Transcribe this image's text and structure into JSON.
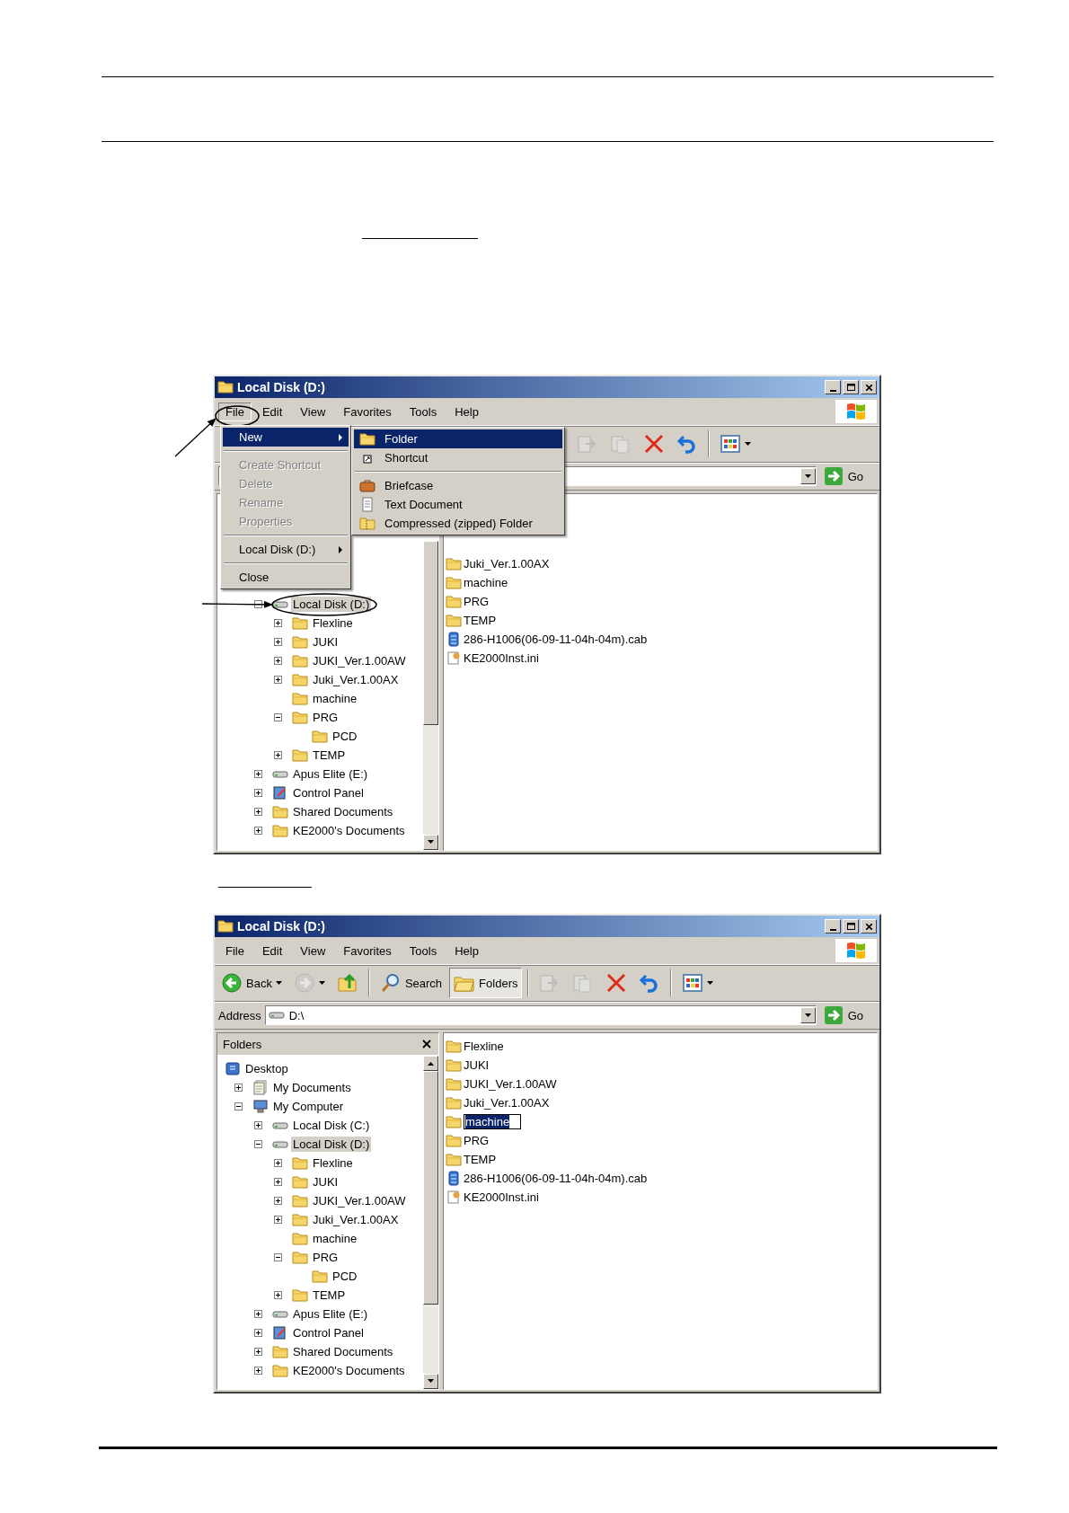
{
  "windows": [
    {
      "title": "Local Disk (D:)",
      "menubar": [
        {
          "label": "File",
          "selected": true
        },
        {
          "label": "Edit",
          "selected": false
        },
        {
          "label": "View",
          "selected": false
        },
        {
          "label": "Favorites",
          "selected": false
        },
        {
          "label": "Tools",
          "selected": false
        },
        {
          "label": "Help",
          "selected": false
        }
      ],
      "file_menu": {
        "items": [
          {
            "kind": "submenu",
            "label": "New",
            "selected": true,
            "disabled": false
          },
          {
            "kind": "separator"
          },
          {
            "kind": "item",
            "label": "Create Shortcut",
            "selected": false,
            "disabled": true
          },
          {
            "kind": "item",
            "label": "Delete",
            "selected": false,
            "disabled": true
          },
          {
            "kind": "item",
            "label": "Rename",
            "selected": false,
            "disabled": true
          },
          {
            "kind": "item",
            "label": "Properties",
            "selected": false,
            "disabled": true
          },
          {
            "kind": "separator"
          },
          {
            "kind": "submenu",
            "label": "Local Disk (D:)",
            "selected": false,
            "disabled": false
          },
          {
            "kind": "separator"
          },
          {
            "kind": "item",
            "label": "Close",
            "selected": false,
            "disabled": false
          }
        ],
        "submenu": [
          {
            "kind": "folder",
            "label": "Folder",
            "selected": true
          },
          {
            "kind": "shortcut",
            "label": "Shortcut",
            "selected": false
          },
          {
            "kind": "separator"
          },
          {
            "kind": "briefcase",
            "label": "Briefcase",
            "selected": false
          },
          {
            "kind": "text-document",
            "label": "Text Document",
            "selected": false
          },
          {
            "kind": "zip-folder",
            "label": "Compressed (zipped) Folder",
            "selected": false
          }
        ]
      },
      "toolbar": [
        {
          "kind": "move",
          "disabled": true,
          "pressed": false
        },
        {
          "kind": "copy",
          "disabled": true,
          "pressed": false
        },
        {
          "kind": "delete",
          "disabled": false,
          "pressed": false
        },
        {
          "kind": "undo",
          "disabled": false,
          "pressed": false
        },
        {
          "kind": "separator"
        },
        {
          "kind": "views",
          "disabled": false,
          "pressed": false
        }
      ],
      "address": {
        "go": "Go"
      },
      "tree": [
        {
          "label": "Local Disk (D:)",
          "kind": "drive",
          "selected": true,
          "expanded": true,
          "children": [
            {
              "label": "Flexline",
              "kind": "folder",
              "selected": false,
              "expanded": false
            },
            {
              "label": "JUKI",
              "kind": "folder",
              "selected": false,
              "expanded": false
            },
            {
              "label": "JUKI_Ver.1.00AW",
              "kind": "folder",
              "selected": false,
              "expanded": false
            },
            {
              "label": "Juki_Ver.1.00AX",
              "kind": "folder",
              "selected": false,
              "expanded": false
            },
            {
              "label": "machine",
              "kind": "folder",
              "selected": false
            },
            {
              "label": "PRG",
              "kind": "folder",
              "selected": false,
              "expanded": true,
              "children": [
                {
                  "label": "PCD",
                  "kind": "folder",
                  "selected": false
                }
              ]
            },
            {
              "label": "TEMP",
              "kind": "folder",
              "selected": false,
              "expanded": false
            }
          ]
        },
        {
          "label": "Apus Elite (E:)",
          "kind": "drive",
          "selected": false,
          "expanded": false
        },
        {
          "label": "Control Panel",
          "kind": "control-panel",
          "selected": false,
          "expanded": false
        },
        {
          "label": "Shared Documents",
          "kind": "folder",
          "selected": false,
          "expanded": false
        },
        {
          "label": "KE2000's Documents",
          "kind": "folder",
          "selected": false,
          "expanded": false
        }
      ],
      "files": [
        {
          "name": "Juki_Ver.1.00AX",
          "kind": "folder",
          "editing": false
        },
        {
          "name": "machine",
          "kind": "folder",
          "editing": false
        },
        {
          "name": "PRG",
          "kind": "folder",
          "editing": false
        },
        {
          "name": "TEMP",
          "kind": "folder",
          "editing": false
        },
        {
          "name": "286-H1006(06-09-11-04h-04m).cab",
          "kind": "cab",
          "editing": false
        },
        {
          "name": "KE2000Inst.ini",
          "kind": "ini",
          "editing": false
        }
      ]
    },
    {
      "title": "Local Disk (D:)",
      "menubar": [
        {
          "label": "File",
          "selected": false
        },
        {
          "label": "Edit",
          "selected": false
        },
        {
          "label": "View",
          "selected": false
        },
        {
          "label": "Favorites",
          "selected": false
        },
        {
          "label": "Tools",
          "selected": false
        },
        {
          "label": "Help",
          "selected": false
        }
      ],
      "toolbar": [
        {
          "kind": "back",
          "label": "Back",
          "disabled": false,
          "pressed": false
        },
        {
          "kind": "forward",
          "disabled": true,
          "pressed": false
        },
        {
          "kind": "up",
          "disabled": false,
          "pressed": false
        },
        {
          "kind": "separator"
        },
        {
          "kind": "search",
          "label": "Search",
          "disabled": false,
          "pressed": false
        },
        {
          "kind": "folders",
          "label": "Folders",
          "disabled": false,
          "pressed": true
        },
        {
          "kind": "separator"
        },
        {
          "kind": "move",
          "disabled": true,
          "pressed": false
        },
        {
          "kind": "copy",
          "disabled": true,
          "pressed": false
        },
        {
          "kind": "delete",
          "disabled": false,
          "pressed": false
        },
        {
          "kind": "undo",
          "disabled": false,
          "pressed": false
        },
        {
          "kind": "separator"
        },
        {
          "kind": "views",
          "disabled": false,
          "pressed": false
        }
      ],
      "address": {
        "label": "Address",
        "value": "D:\\",
        "go": "Go"
      },
      "folders_pane": {
        "title": "Folders"
      },
      "tree": [
        {
          "label": "Desktop",
          "kind": "desktop",
          "selected": false,
          "children": [
            {
              "label": "My Documents",
              "kind": "documents",
              "selected": false,
              "expanded": false
            },
            {
              "label": "My Computer",
              "kind": "computer",
              "selected": false,
              "expanded": true,
              "children": [
                {
                  "label": "Local Disk (C:)",
                  "kind": "drive",
                  "selected": false,
                  "expanded": false
                },
                {
                  "label": "Local Disk (D:)",
                  "kind": "drive",
                  "selected": true,
                  "expanded": true,
                  "children": [
                    {
                      "label": "Flexline",
                      "kind": "folder",
                      "selected": false,
                      "expanded": false
                    },
                    {
                      "label": "JUKI",
                      "kind": "folder",
                      "selected": false,
                      "expanded": false
                    },
                    {
                      "label": "JUKI_Ver.1.00AW",
                      "kind": "folder",
                      "selected": false,
                      "expanded": false
                    },
                    {
                      "label": "Juki_Ver.1.00AX",
                      "kind": "folder",
                      "selected": false,
                      "expanded": false
                    },
                    {
                      "label": "machine",
                      "kind": "folder",
                      "selected": false
                    },
                    {
                      "label": "PRG",
                      "kind": "folder",
                      "selected": false,
                      "expanded": true,
                      "children": [
                        {
                          "label": "PCD",
                          "kind": "folder",
                          "selected": false
                        }
                      ]
                    },
                    {
                      "label": "TEMP",
                      "kind": "folder",
                      "selected": false,
                      "expanded": false
                    }
                  ]
                },
                {
                  "label": "Apus Elite (E:)",
                  "kind": "drive",
                  "selected": false,
                  "expanded": false
                },
                {
                  "label": "Control Panel",
                  "kind": "control-panel",
                  "selected": false,
                  "expanded": false
                },
                {
                  "label": "Shared Documents",
                  "kind": "folder",
                  "selected": false,
                  "expanded": false
                },
                {
                  "label": "KE2000's Documents",
                  "kind": "folder",
                  "selected": false,
                  "expanded": false
                }
              ]
            }
          ]
        }
      ],
      "files": [
        {
          "name": "Flexline",
          "kind": "folder",
          "editing": false
        },
        {
          "name": "JUKI",
          "kind": "folder",
          "editing": false
        },
        {
          "name": "JUKI_Ver.1.00AW",
          "kind": "folder",
          "editing": false
        },
        {
          "name": "Juki_Ver.1.00AX",
          "kind": "folder",
          "editing": false
        },
        {
          "name": "machine",
          "kind": "folder",
          "editing": true
        },
        {
          "name": "PRG",
          "kind": "folder",
          "editing": false
        },
        {
          "name": "TEMP",
          "kind": "folder",
          "editing": false
        },
        {
          "name": "286-H1006(06-09-11-04h-04m).cab",
          "kind": "cab",
          "editing": false
        },
        {
          "name": "KE2000Inst.ini",
          "kind": "ini",
          "editing": false
        }
      ]
    }
  ]
}
